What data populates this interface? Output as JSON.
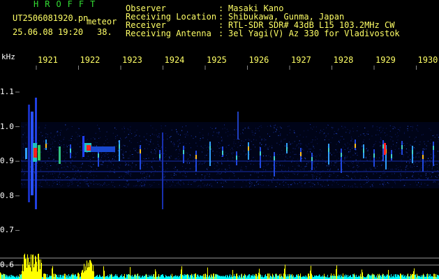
{
  "header": {
    "app_name": "HROFFT",
    "file_name": "UT2506081920.pn",
    "file_suffix": "meteor",
    "datetime": "25.06.08 19:20",
    "count": "38.",
    "fields": [
      {
        "label": "Observer",
        "value": "Masaki Kano"
      },
      {
        "label": "Receiving Location",
        "value": "Shibukawa, Gunma, Japan"
      },
      {
        "label": "Receiver",
        "value": "RTL-SDR SDR# 43dB L15 103.2MHz CW"
      },
      {
        "label": "Receiving Antenna",
        "value": "3el Yagi(V) Az 330 for Vladivostok"
      }
    ],
    "separator": ":"
  },
  "axis": {
    "unit": "kHz",
    "time_ticks": [
      "1921",
      "1922",
      "1923",
      "1924",
      "1925",
      "1926",
      "1927",
      "1928",
      "1929",
      "1930"
    ],
    "freq_ticks": [
      "1.1",
      "1.0",
      "0.9",
      "0.8",
      "0.7",
      "0.6"
    ]
  },
  "colors": {
    "text_header": "#ffff66",
    "title": "#33dd33",
    "tick_label": "#ffff66",
    "signal_hot": "#ff2020",
    "signal_mid": "#20c0c0",
    "signal_low": "#2040ff",
    "level_bar": "#ffff00",
    "level_line": "#00ffff"
  }
}
